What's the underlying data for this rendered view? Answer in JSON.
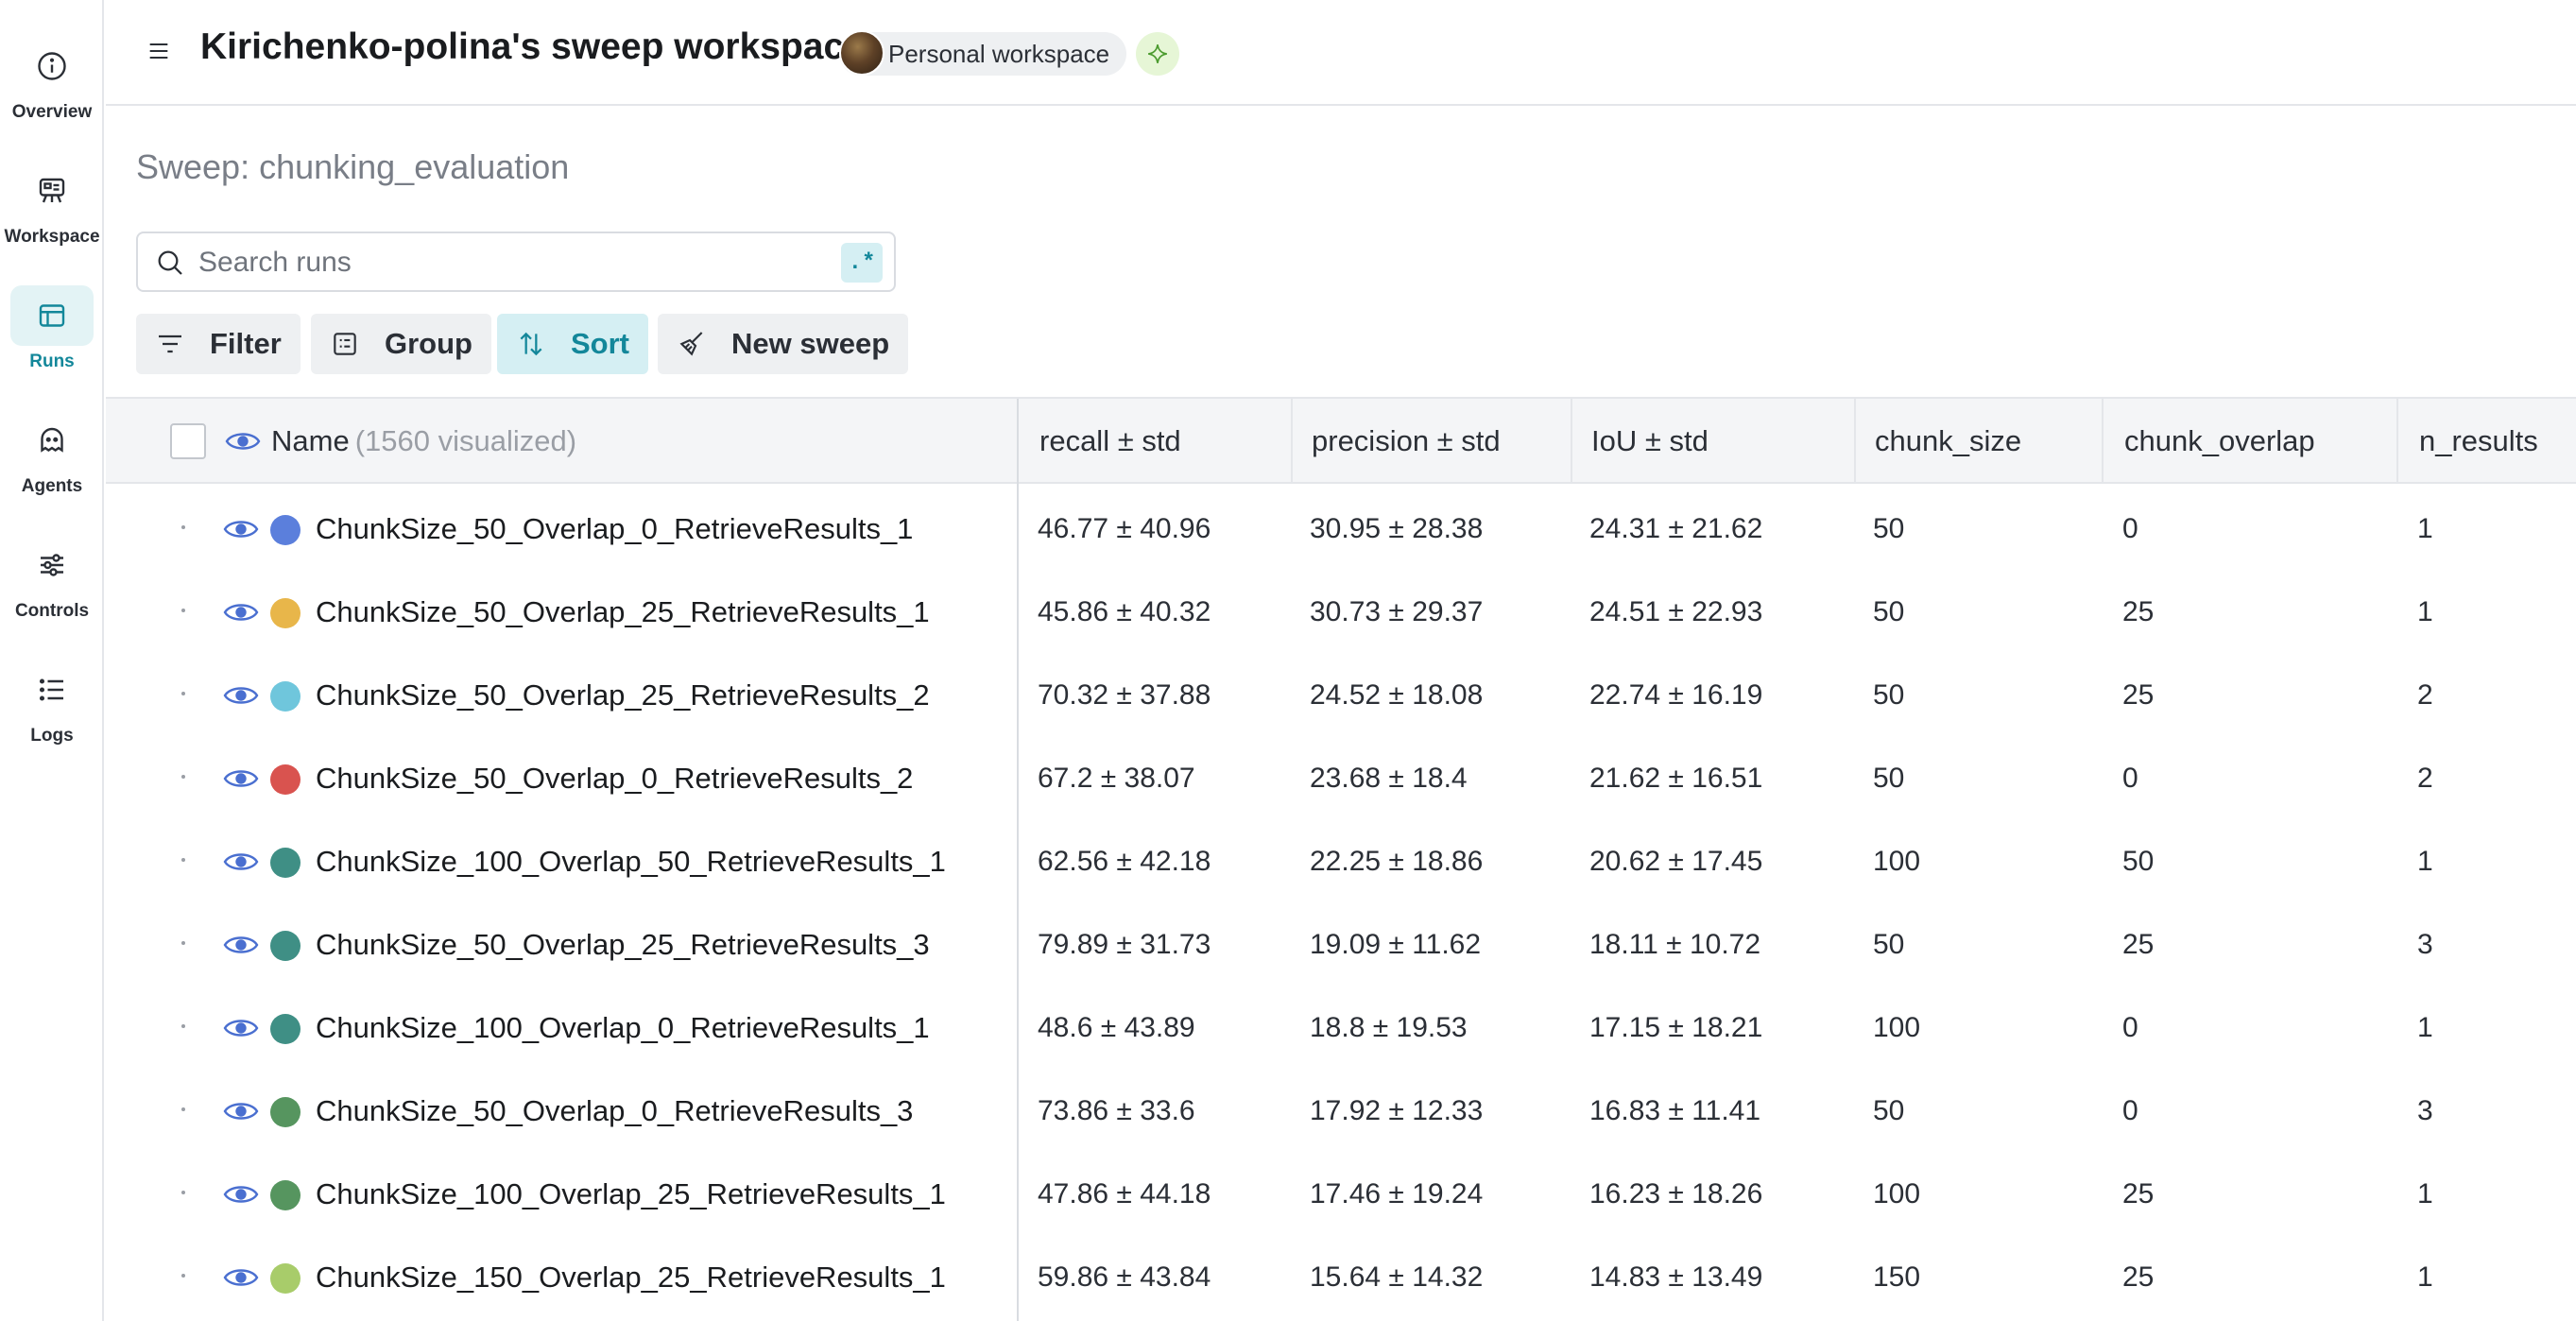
{
  "rail": [
    {
      "key": "overview",
      "label": "Overview",
      "icon": "info-icon"
    },
    {
      "key": "workspace",
      "label": "Workspace",
      "icon": "workspace-icon"
    },
    {
      "key": "runs",
      "label": "Runs",
      "icon": "table-icon",
      "active": true
    },
    {
      "key": "agents",
      "label": "Agents",
      "icon": "agent-ghost-icon"
    },
    {
      "key": "controls",
      "label": "Controls",
      "icon": "sliders-icon"
    },
    {
      "key": "logs",
      "label": "Logs",
      "icon": "list-icon"
    }
  ],
  "header": {
    "title": "Kirichenko-polina's sweep workspace",
    "workspace_chip": "Personal workspace"
  },
  "sweep": {
    "title": "Sweep: chunking_evaluation",
    "search_placeholder": "Search runs",
    "regex_label": ".*"
  },
  "toolbar": {
    "filter": "Filter",
    "group": "Group",
    "sort": "Sort",
    "new_sweep": "New sweep"
  },
  "table": {
    "name_header": "Name",
    "name_header_count": "(1560 visualized)",
    "columns": [
      "recall ± std",
      "precision ± std",
      "IoU ± std",
      "chunk_size",
      "chunk_overlap",
      "n_results"
    ],
    "rows": [
      {
        "color": "#5b7fdc",
        "name": "ChunkSize_50_Overlap_0_RetrieveResults_1",
        "cells": [
          "46.77 ± 40.96",
          "30.95 ± 28.38",
          "24.31 ± 21.62",
          "50",
          "0",
          "1"
        ]
      },
      {
        "color": "#e8b64a",
        "name": "ChunkSize_50_Overlap_25_RetrieveResults_1",
        "cells": [
          "45.86 ± 40.32",
          "30.73 ± 29.37",
          "24.51 ± 22.93",
          "50",
          "25",
          "1"
        ]
      },
      {
        "color": "#6fc6dc",
        "name": "ChunkSize_50_Overlap_25_RetrieveResults_2",
        "cells": [
          "70.32 ± 37.88",
          "24.52 ± 18.08",
          "22.74 ± 16.19",
          "50",
          "25",
          "2"
        ]
      },
      {
        "color": "#d9534f",
        "name": "ChunkSize_50_Overlap_0_RetrieveResults_2",
        "cells": [
          "67.2 ± 38.07",
          "23.68 ± 18.4",
          "21.62 ± 16.51",
          "50",
          "0",
          "2"
        ]
      },
      {
        "color": "#3f8f85",
        "name": "ChunkSize_100_Overlap_50_RetrieveResults_1",
        "cells": [
          "62.56 ± 42.18",
          "22.25 ± 18.86",
          "20.62 ± 17.45",
          "100",
          "50",
          "1"
        ]
      },
      {
        "color": "#3f8f85",
        "name": "ChunkSize_50_Overlap_25_RetrieveResults_3",
        "cells": [
          "79.89 ± 31.73",
          "19.09 ± 11.62",
          "18.11 ± 10.72",
          "50",
          "25",
          "3"
        ]
      },
      {
        "color": "#3f8f85",
        "name": "ChunkSize_100_Overlap_0_RetrieveResults_1",
        "cells": [
          "48.6 ± 43.89",
          "18.8 ± 19.53",
          "17.15 ± 18.21",
          "100",
          "0",
          "1"
        ]
      },
      {
        "color": "#56955f",
        "name": "ChunkSize_50_Overlap_0_RetrieveResults_3",
        "cells": [
          "73.86 ± 33.6",
          "17.92 ± 12.33",
          "16.83 ± 11.41",
          "50",
          "0",
          "3"
        ]
      },
      {
        "color": "#56955f",
        "name": "ChunkSize_100_Overlap_25_RetrieveResults_1",
        "cells": [
          "47.86 ± 44.18",
          "17.46 ± 19.24",
          "16.23 ± 18.26",
          "100",
          "25",
          "1"
        ]
      },
      {
        "color": "#a8cc6a",
        "name": "ChunkSize_150_Overlap_25_RetrieveResults_1",
        "cells": [
          "59.86 ± 43.84",
          "15.64 ± 14.32",
          "14.83 ± 13.49",
          "150",
          "25",
          "1"
        ]
      }
    ]
  }
}
